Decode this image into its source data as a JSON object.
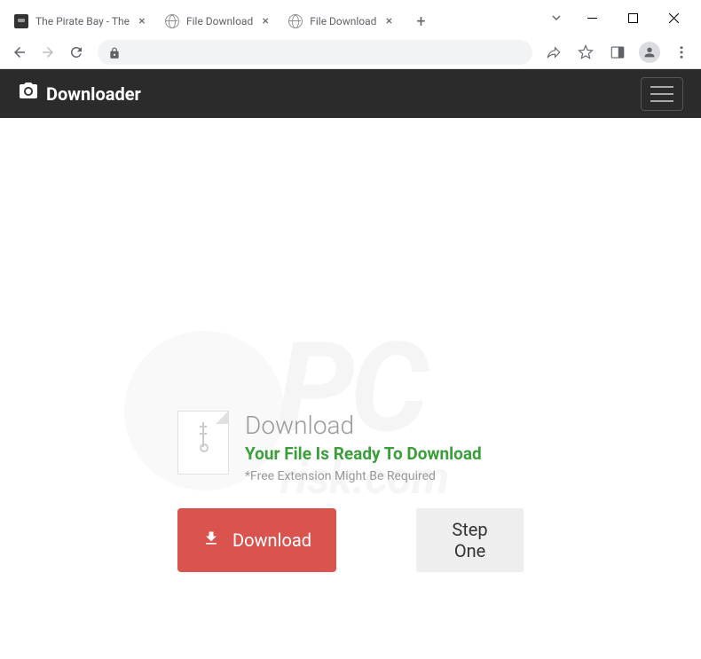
{
  "browser": {
    "tabs": [
      {
        "title": "The Pirate Bay - The",
        "favicon": "pb",
        "active": false
      },
      {
        "title": "File Download",
        "favicon": "globe",
        "active": false
      },
      {
        "title": "File Download",
        "favicon": "globe",
        "active": true
      }
    ]
  },
  "page": {
    "brand": "Downloader",
    "heading": "Download",
    "subheading": "Your File Is Ready To Download",
    "note": "*Free Extension Might Be Required",
    "download_button": "Download",
    "step_button": "Step One"
  },
  "watermark": {
    "main": "PC",
    "sub": "risk.com"
  }
}
